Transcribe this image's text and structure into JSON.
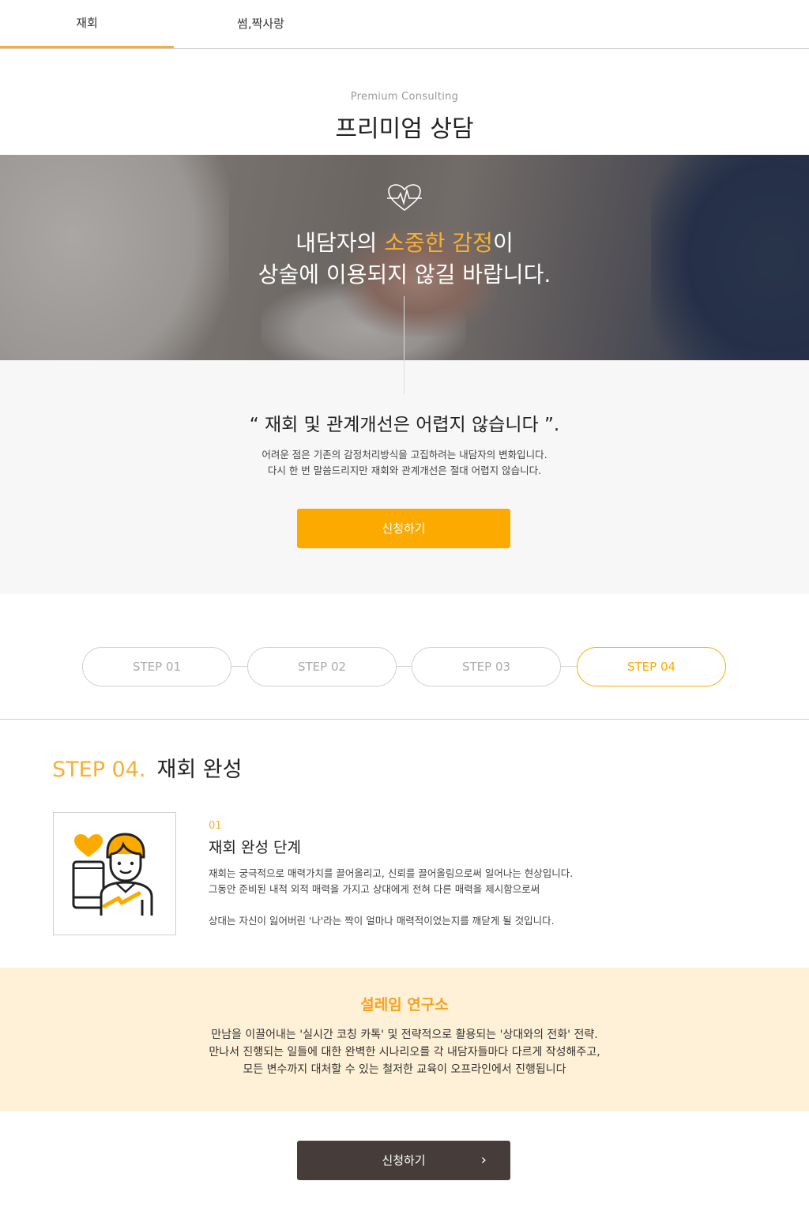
{
  "tabs": [
    {
      "label": "재회"
    },
    {
      "label": "썸,짝사랑"
    }
  ],
  "header": {
    "subtitle": "Premium Consulting",
    "title": "프리미엄 상담"
  },
  "hero": {
    "icon": "heartbeat-icon",
    "line1_pre": "내담자의 ",
    "line1_accent": "소중한 감정",
    "line1_post": "이",
    "line2": "상술에 이용되지 않길 바랍니다."
  },
  "intro": {
    "quote": "“ 재회 및 관계개선은 어렵지 않습니다 ”.",
    "para_line1": "어려운 점은 기존의 감정처리방식을 고집하려는 내담자의 변화입니다.",
    "para_line2": "다시 한 번 말씀드리지만 재회와 관계개선은 절대 어렵지 않습니다.",
    "button": "신청하기"
  },
  "steps": [
    {
      "label": "STEP 01"
    },
    {
      "label": "STEP 02"
    },
    {
      "label": "STEP 03"
    },
    {
      "label": "STEP 04"
    }
  ],
  "step_detail": {
    "num": "STEP 04.",
    "title": "재회 완성",
    "item_num": "01",
    "item_title": "재회 완성 단계",
    "line1": "재회는 궁극적으로 매력가치를 끌어올리고, 신뢰를 끌어올림으로써 일어나는 현상입니다.",
    "line2": "그동안 준비된 내적 외적 매력을 가지고 상대에게 전혀 다른 매력을 제시함으로써",
    "line3": "상대는 자신이 잃어버린 '나'라는 짝이 얼마나 매력적이었는지를 깨닫게 될 것입니다."
  },
  "lab": {
    "title": "설레임 연구소",
    "line1": "만남을 이끌어내는 '실시간 코칭 카톡' 및 전략적으로 활용되는  '상대와의 전화' 전략.",
    "line2": "만나서 진행되는 일들에 대한 완벽한 시나리오를 각 내담자들마다 다르게 작성해주고,",
    "line3": "모든 변수까지 대처할 수 있는 철저한 교육이 오프라인에서 진행됩니다"
  },
  "cta": {
    "button": "신청하기",
    "icon": "chevron-right-icon"
  },
  "colors": {
    "accent": "#f7b033",
    "button_orange": "#fcaa00",
    "button_dark": "#463d3a",
    "lab_bg": "#fff1d7"
  }
}
